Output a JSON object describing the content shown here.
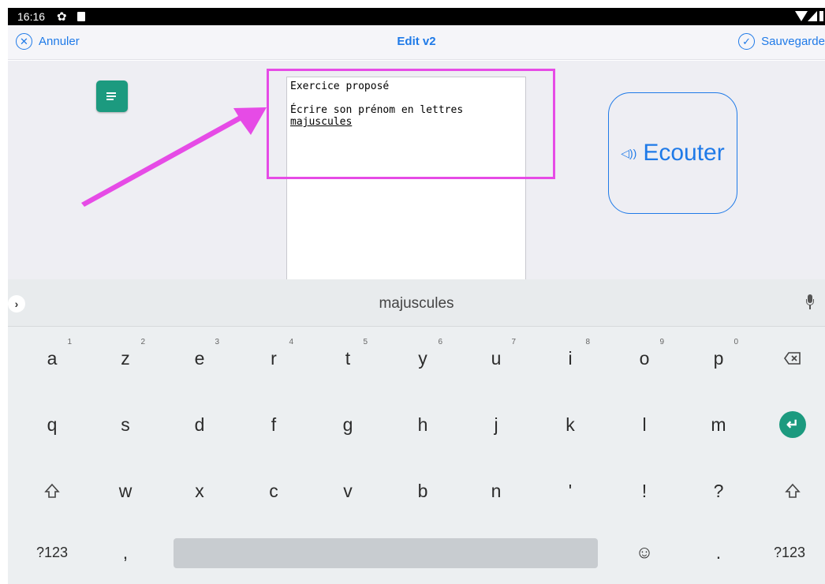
{
  "status_bar": {
    "time": "16:16"
  },
  "nav": {
    "cancel_label": "Annuler",
    "title": "Edit v2",
    "save_label": "Sauvegarde"
  },
  "editor": {
    "line1": "Exercice proposé",
    "line2": "Écrire son prénom en lettres",
    "line3": "majuscules"
  },
  "listen_button": {
    "label": "Ecouter",
    "icon": "speaker-icon"
  },
  "keyboard": {
    "suggestion": "majuscules",
    "row1": [
      {
        "label": "a",
        "num": "1"
      },
      {
        "label": "z",
        "num": "2"
      },
      {
        "label": "e",
        "num": "3"
      },
      {
        "label": "r",
        "num": "4"
      },
      {
        "label": "t",
        "num": "5"
      },
      {
        "label": "y",
        "num": "6"
      },
      {
        "label": "u",
        "num": "7"
      },
      {
        "label": "i",
        "num": "8"
      },
      {
        "label": "o",
        "num": "9"
      },
      {
        "label": "p",
        "num": "0"
      }
    ],
    "row2": [
      "q",
      "s",
      "d",
      "f",
      "g",
      "h",
      "j",
      "k",
      "l",
      "m"
    ],
    "row3": [
      "w",
      "x",
      "c",
      "v",
      "b",
      "n",
      "'",
      "!",
      "?"
    ],
    "row4": {
      "symbols_left": "?123",
      "comma": ",",
      "period": ".",
      "symbols_right": "?123"
    }
  },
  "colors": {
    "accent": "#1f7ae8",
    "annotation": "#e64be6",
    "doc_icon": "#1c9a7f",
    "enter": "#1c9a7f"
  }
}
